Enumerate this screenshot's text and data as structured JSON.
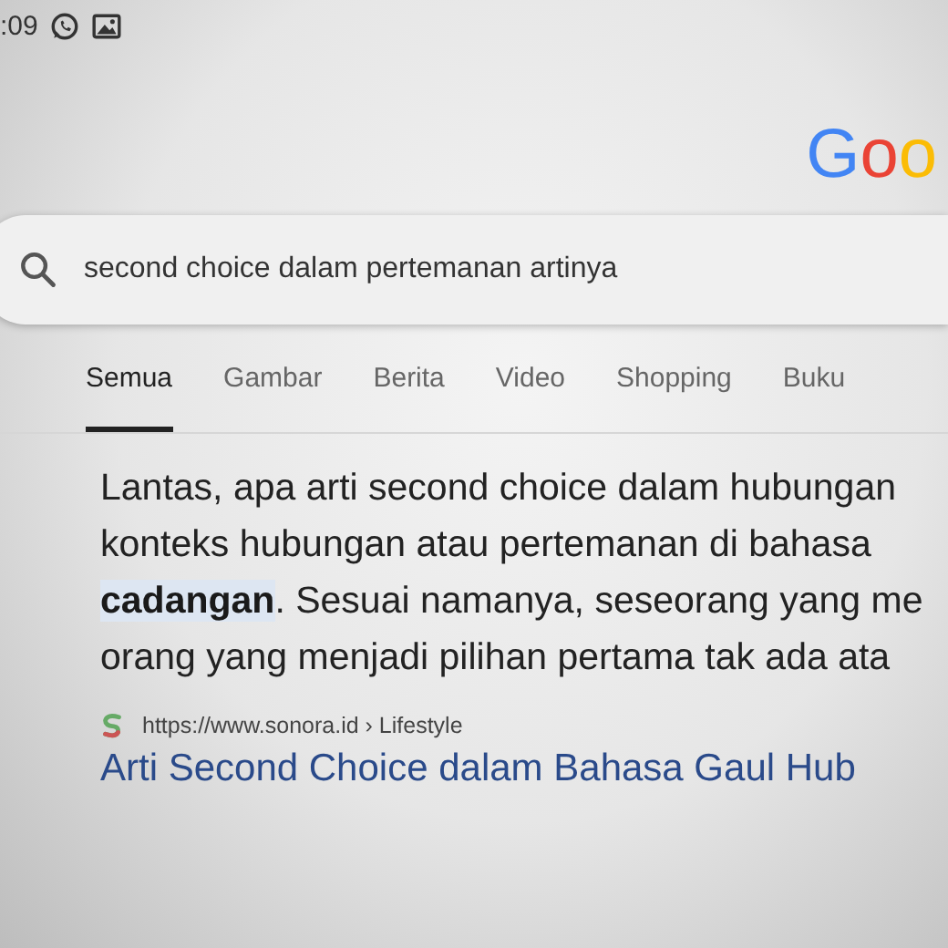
{
  "status_bar": {
    "time": ":09"
  },
  "logo": "Goo",
  "search": {
    "value": "second choice dalam pertemanan artinya"
  },
  "tabs": [
    {
      "label": "Semua",
      "selected": true
    },
    {
      "label": "Gambar",
      "selected": false
    },
    {
      "label": "Berita",
      "selected": false
    },
    {
      "label": "Video",
      "selected": false
    },
    {
      "label": "Shopping",
      "selected": false
    },
    {
      "label": "Buku",
      "selected": false
    }
  ],
  "result": {
    "snippet_lines": [
      "Lantas, apa arti second choice dalam hubungan",
      "konteks hubungan atau pertemanan di bahasa",
      "**cadangan**. Sesuai namanya, seseorang yang me",
      "orang yang menjadi pilihan pertama tak ada ata"
    ],
    "source": "https://www.sonora.id › Lifestyle",
    "title": "Arti Second Choice dalam Bahasa Gaul Hub"
  }
}
